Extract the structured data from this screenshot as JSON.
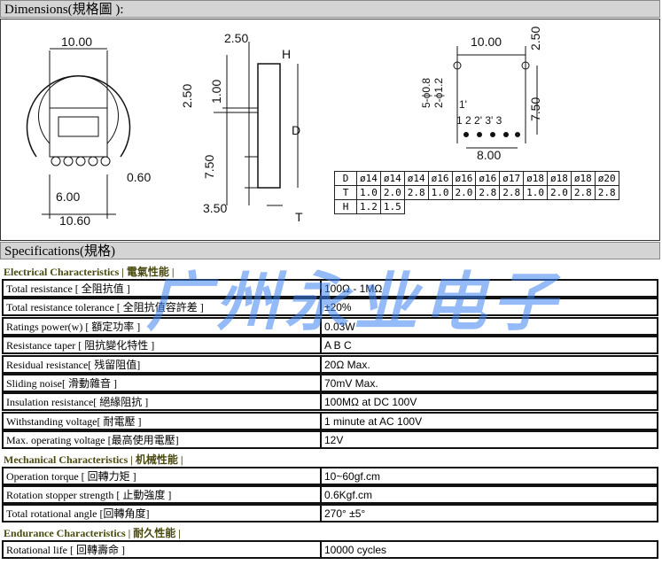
{
  "dimensions_title": "Dimensions(規格圖 ):",
  "drawing_labels": {
    "w1": "10.00",
    "h1": "2.50",
    "w2": "6.00",
    "w3": "0.60",
    "w4": "10.60",
    "s1": "2.50",
    "s2": "1.00",
    "s3": "7.50",
    "s4": "3.50",
    "H": "H",
    "D": "D",
    "T": "T",
    "p1": "10.00",
    "p2": "2.50",
    "p3": "5-ϕ0.8",
    "p4": "2-ϕ1.2",
    "p5": "1'",
    "p6": "1 2 2' 3' 3",
    "p7": "7.50",
    "p8": "8.00"
  },
  "size_table": {
    "rows": [
      [
        "D",
        "ø14",
        "ø14",
        "ø14",
        "ø16",
        "ø16",
        "ø16",
        "ø17",
        "ø18",
        "ø18",
        "ø18",
        "ø20"
      ],
      [
        "T",
        "1.0",
        "2.0",
        "2.8",
        "1.0",
        "2.0",
        "2.8",
        "2.8",
        "1.0",
        "2.0",
        "2.8",
        "2.8"
      ],
      [
        "H",
        "1.2",
        "1.5"
      ]
    ]
  },
  "specifications_title": "Specifications(規格)",
  "watermark": "广州永业电子",
  "sections": [
    {
      "title": "Electrical Characteristics | 電氣性能 |",
      "rows": [
        [
          "Total resistance [ 全阻抗值 ]",
          "100Ω - 1MΩ"
        ],
        [
          "Total resistance tolerance [ 全阻抗值容許差 ]",
          "±20%"
        ],
        [
          "Ratings power(w) [ 額定功率 ]",
          "0.03W"
        ],
        [
          "Resistance taper [ 阻抗變化特性 ]",
          "A  B  C"
        ],
        [
          "Residual resistance[ 残留阻值]",
          "20Ω  Max."
        ],
        [
          "Sliding noise[ 滑動雜音 ]",
          "70mV  Max."
        ],
        [
          "Insulation resistance[ 絕緣阻抗 ]",
          "100MΩ at DC 100V"
        ],
        [
          "Withstanding voltage[ 耐電壓 ]",
          "1 minute at AC 100V"
        ],
        [
          "Max. operating voltage [最高使用電壓]",
          "12V"
        ]
      ]
    },
    {
      "title": "Mechanical Characteristics | 机械性能 |",
      "rows": [
        [
          "Operation torque [ 回轉力矩 ]",
          "10~60gf.cm"
        ],
        [
          "Rotation stopper strength [ 止動強度 ]",
          "0.6Kgf.cm"
        ],
        [
          "Total rotational angle [回轉角度]",
          "270° ±5°"
        ]
      ]
    },
    {
      "title": "Endurance Characteristics | 耐久性能 |",
      "rows": [
        [
          "Rotational life [ 回轉壽命 ]",
          "10000 cycles"
        ]
      ]
    }
  ]
}
